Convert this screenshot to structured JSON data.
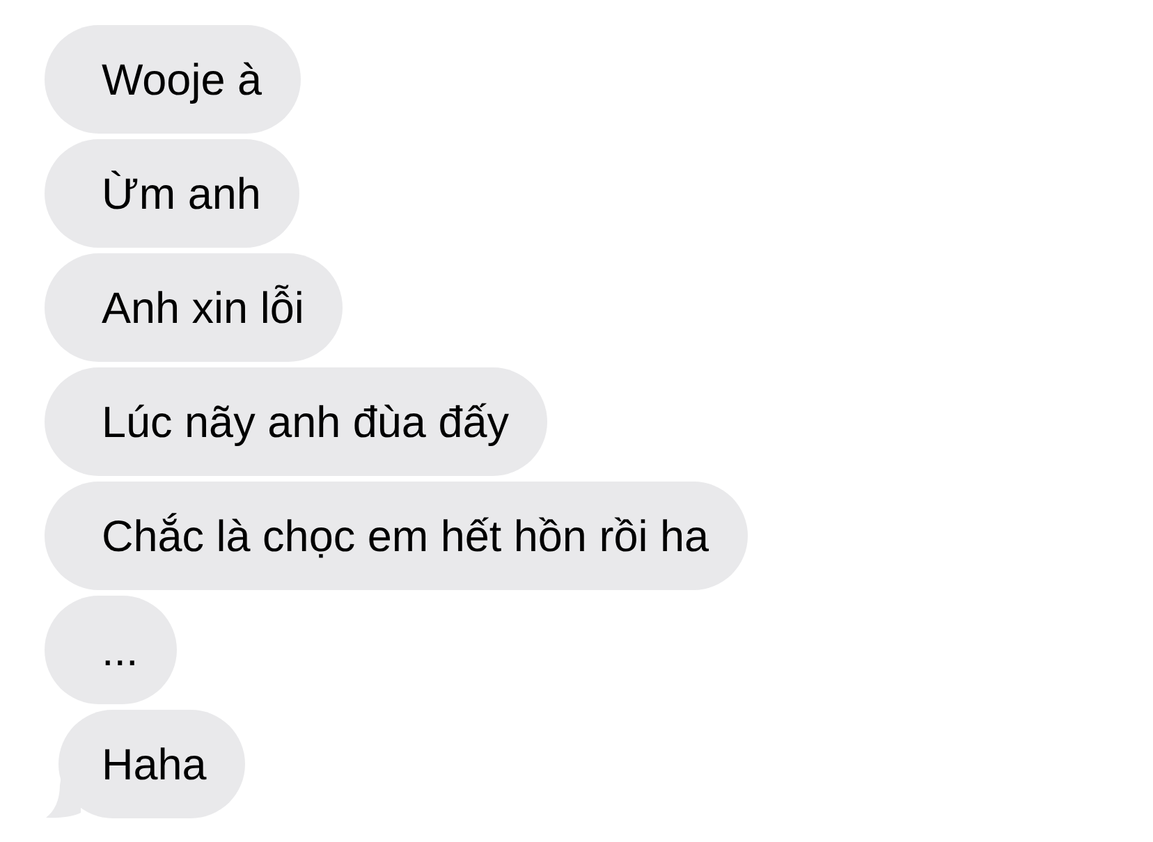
{
  "messages": [
    {
      "text": "Wooje à",
      "tail": false
    },
    {
      "text": "Ừm anh",
      "tail": false
    },
    {
      "text": "Anh xin lỗi",
      "tail": false
    },
    {
      "text": "Lúc nãy anh đùa đấy",
      "tail": false
    },
    {
      "text": "Chắc là chọc em hết hồn rồi ha",
      "tail": false
    },
    {
      "text": "...",
      "tail": false
    },
    {
      "text": "Haha",
      "tail": true
    }
  ]
}
